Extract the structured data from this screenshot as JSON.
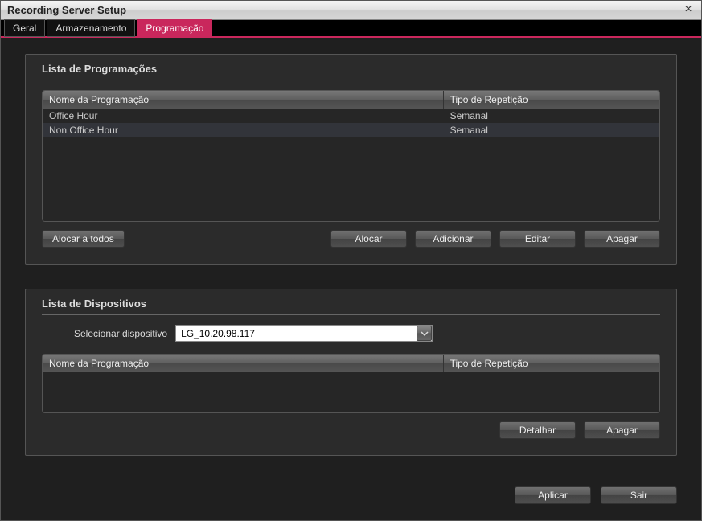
{
  "window": {
    "title": "Recording Server Setup"
  },
  "tabs": {
    "general": "Geral",
    "storage": "Armazenamento",
    "schedule": "Programação"
  },
  "sched_panel": {
    "title": "Lista de Programações",
    "col_name": "Nome da Programação",
    "col_type": "Tipo de Repetição",
    "rows": [
      {
        "name": "Office Hour",
        "type": "Semanal"
      },
      {
        "name": "Non Office Hour",
        "type": "Semanal"
      }
    ],
    "btn_alloc_all": "Alocar a todos",
    "btn_alloc": "Alocar",
    "btn_add": "Adicionar",
    "btn_edit": "Editar",
    "btn_del": "Apagar"
  },
  "dev_panel": {
    "title": "Lista de Dispositivos",
    "select_label": "Selecionar dispositivo",
    "select_value": "LG_10.20.98.117",
    "col_name": "Nome da Programação",
    "col_type": "Tipo de Repetição",
    "btn_detail": "Detalhar",
    "btn_del": "Apagar"
  },
  "footer": {
    "apply": "Aplicar",
    "exit": "Sair"
  }
}
